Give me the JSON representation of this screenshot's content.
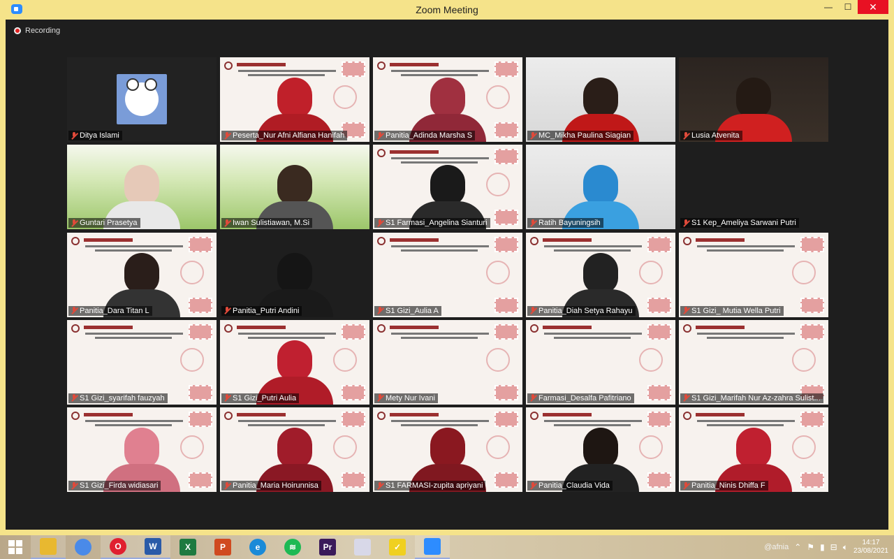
{
  "window": {
    "title": "Zoom Meeting",
    "minimize": "—",
    "maximize": "☐",
    "close": "✕"
  },
  "recording": {
    "label": "Recording"
  },
  "participants": [
    {
      "name": "Ditya Islami",
      "bg": "avatar-bg",
      "avatar": true
    },
    {
      "name": "Peserta_Nur Afni Alfiana Hanifah",
      "bg": "slide",
      "person": {
        "head": "#c0202a",
        "body": "#b01c24"
      }
    },
    {
      "name": "Panitia_Adinda Marsha S",
      "bg": "slide",
      "person": {
        "head": "#a03040",
        "body": "#902838"
      }
    },
    {
      "name": "MC_Mikha Paulina Siagian",
      "bg": "room",
      "person": {
        "head": "#2a1e18",
        "body": "#c01818"
      }
    },
    {
      "name": "Lusia Atvenita",
      "bg": "night",
      "person": {
        "head": "#241a14",
        "body": "#d02020"
      }
    },
    {
      "name": "Guntari Prasetya",
      "bg": "grass",
      "person": {
        "head": "#e6c9b8",
        "body": "#e8e8e8"
      }
    },
    {
      "name": "Iwan Sulistiawan, M.Si",
      "bg": "grass",
      "person": {
        "head": "#3a2a20",
        "body": "#555555"
      },
      "active": true
    },
    {
      "name": "S1 Farmasi_Angelina Sianturi",
      "bg": "slide",
      "person": {
        "head": "#1a1a1a",
        "body": "#2a2a2a"
      }
    },
    {
      "name": "Ratih Bayuningsih",
      "bg": "room",
      "person": {
        "head": "#2a8ad0",
        "body": "#3aa0e0"
      }
    },
    {
      "name": "S1 Kep_Ameliya Sarwani Putri",
      "bg": "dark"
    },
    {
      "name": "Panitia_Dara Titan L",
      "bg": "slide",
      "person": {
        "head": "#2a1e1a",
        "body": "#333333"
      }
    },
    {
      "name": "Panitia_Putri Andini",
      "bg": "dark",
      "person": {
        "head": "#151515",
        "body": "#1a1a1a"
      }
    },
    {
      "name": "S1 Gizi_Aulia A",
      "bg": "slide"
    },
    {
      "name": "Panitia_Diah Setya Rahayu",
      "bg": "slide",
      "person": {
        "head": "#222222",
        "body": "#2a2a2a"
      }
    },
    {
      "name": "S1 Gizi_ Mutia Wella Putri",
      "bg": "slide"
    },
    {
      "name": "S1 Gizi_syarifah fauzyah",
      "bg": "slide"
    },
    {
      "name": "S1 Gizi_Putri Aulia",
      "bg": "slide",
      "person": {
        "head": "#c02030",
        "body": "#b01c28"
      }
    },
    {
      "name": "Mety Nur Ivani",
      "bg": "slide"
    },
    {
      "name": "Farmasi_Desalfa Pafitriano",
      "bg": "slide"
    },
    {
      "name": "S1 Gizi_Marifah Nur Az-zahra Sulist...",
      "bg": "slide"
    },
    {
      "name": "S1 Gizi_Firda widiasari",
      "bg": "slide",
      "person": {
        "head": "#e08090",
        "body": "#d07080"
      }
    },
    {
      "name": "Panitia_Maria Hoirunnisa",
      "bg": "slide",
      "person": {
        "head": "#a01c2a",
        "body": "#8a1824"
      }
    },
    {
      "name": "S1 FARMASI-zupita apriyani",
      "bg": "slide",
      "person": {
        "head": "#8a1820",
        "body": "#801820"
      }
    },
    {
      "name": "Panitia_Claudia Vida",
      "bg": "slide",
      "person": {
        "head": "#1e1612",
        "body": "#222222"
      }
    },
    {
      "name": "Panitia_Ninis Dhiffa F",
      "bg": "slide",
      "person": {
        "head": "#c02030",
        "body": "#b01c2a"
      }
    }
  ],
  "taskbar": {
    "apps": [
      {
        "name": "file-explorer",
        "color": "#e8b830",
        "glyph": "",
        "open": true
      },
      {
        "name": "chrome",
        "color": "#4a8ae8",
        "glyph": "",
        "open": false
      },
      {
        "name": "opera",
        "color": "#e02030",
        "glyph": "O",
        "open": true
      },
      {
        "name": "word",
        "color": "#2a5aa8",
        "glyph": "W",
        "open": true
      },
      {
        "name": "excel",
        "color": "#1e7a40",
        "glyph": "X",
        "open": false
      },
      {
        "name": "powerpoint",
        "color": "#d04a20",
        "glyph": "P",
        "open": false
      },
      {
        "name": "edge",
        "color": "#1a8ad8",
        "glyph": "e",
        "open": false
      },
      {
        "name": "spotify",
        "color": "#1db954",
        "glyph": "≋",
        "open": false
      },
      {
        "name": "premiere",
        "color": "#3a1a5a",
        "glyph": "Pr",
        "open": false
      },
      {
        "name": "paint",
        "color": "#d8d8e8",
        "glyph": "",
        "open": false
      },
      {
        "name": "sticky-notes",
        "color": "#f0d020",
        "glyph": "✓",
        "open": false
      },
      {
        "name": "zoom",
        "color": "#2d8cff",
        "glyph": "",
        "open": true
      }
    ],
    "tray_user": "@afnia",
    "time": "14:17",
    "date": "23/08/2021"
  }
}
